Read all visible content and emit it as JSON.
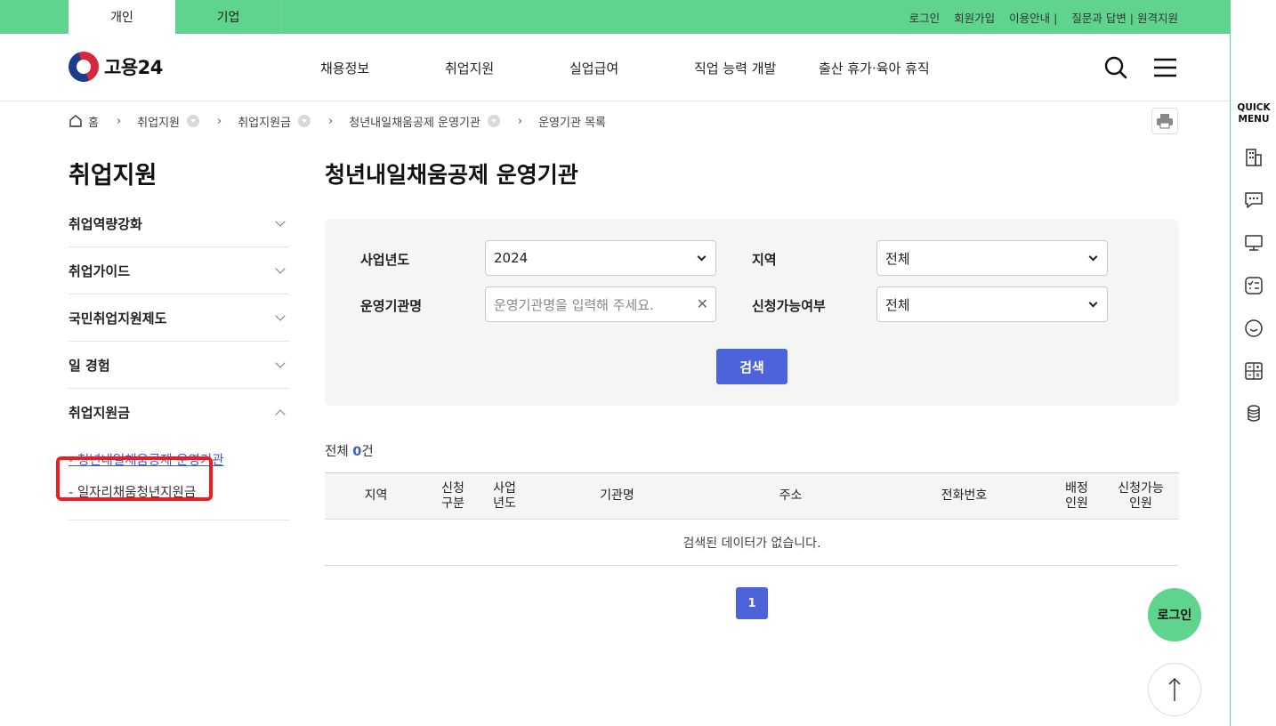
{
  "topbar": {
    "tabs": [
      {
        "label": "개인",
        "active": true
      },
      {
        "label": "기업",
        "active": false
      }
    ],
    "links": [
      "로그인",
      "회원가입",
      "이용안내 |",
      "질문과 답변 | 원격지원"
    ]
  },
  "header": {
    "logo_text": "고용24",
    "nav": [
      "채용정보",
      "취업지원",
      "실업급여",
      "직업 능력 개발",
      "출산 휴가·육아 휴직"
    ],
    "search_icon": "search-icon",
    "menu_icon": "hamburger-menu-icon"
  },
  "breadcrumb": {
    "home": "홈",
    "items": [
      "취업지원",
      "취업지원금",
      "청년내일채움공제 운영기관",
      "운영기관 목록"
    ]
  },
  "lnb": {
    "title": "취업지원",
    "items": [
      {
        "label": "취업역량강화",
        "expanded": false
      },
      {
        "label": "취업가이드",
        "expanded": false
      },
      {
        "label": "국민취업지원제도",
        "expanded": false
      },
      {
        "label": "일 경험",
        "expanded": false
      },
      {
        "label": "취업지원금",
        "expanded": true
      }
    ],
    "sub_items": [
      {
        "label": "- 청년내일채움공제 운영기관",
        "current": true
      },
      {
        "label": "- 일자리채움청년지원금",
        "current": false
      }
    ]
  },
  "main": {
    "title": "청년내일채움공제 운영기관",
    "search": {
      "year_label": "사업년도",
      "year_value": "2024",
      "region_label": "지역",
      "region_value": "전체",
      "org_label": "운영기관명",
      "org_placeholder": "운영기관명을 입력해 주세요.",
      "apply_label": "신청가능여부",
      "apply_value": "전체",
      "button": "검색"
    },
    "total_prefix": "전체 ",
    "total_count": "0",
    "total_suffix": "건",
    "table": {
      "headers": [
        "지역",
        "신청\n구분",
        "사업\n년도",
        "기관명",
        "주소",
        "전화번호",
        "배정\n인원",
        "신청가능\n인원"
      ],
      "empty_message": "검색된 데이터가 없습니다."
    },
    "pagination": [
      "1"
    ]
  },
  "quick_menu": {
    "title_line1": "QUICK",
    "title_line2": "MENU",
    "icons": [
      "building-icon",
      "chat-bubble-icon",
      "monitor-icon",
      "checklist-icon",
      "smile-icon",
      "calculator-icon",
      "coins-icon"
    ]
  },
  "floating": {
    "login": "로그인",
    "top_icon": "arrow-up-icon"
  },
  "colors": {
    "brand_green": "#5fd48e",
    "accent_blue": "#4c63d9",
    "highlight_red": "#ee1c1c"
  }
}
